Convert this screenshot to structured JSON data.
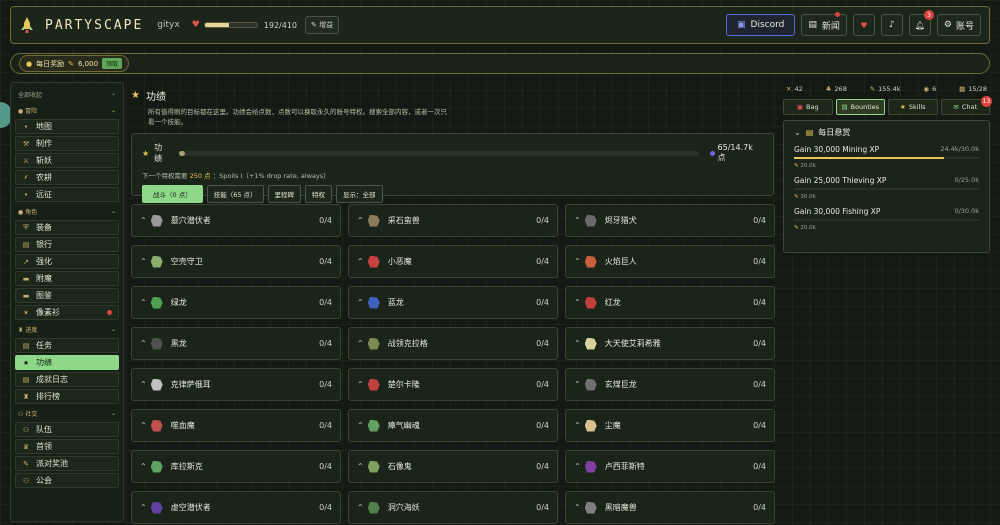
{
  "header": {
    "logo": "PARTYSCAPE",
    "username": "gityx",
    "hp_text": "192/410",
    "hp_fraction": 0.468,
    "boost_label": "增益",
    "discord_label": "Discord",
    "news_label": "新闻",
    "notif_badge": "3",
    "account_label": "账号"
  },
  "daily": {
    "label": "每日奖励",
    "amount": "6,000",
    "claim_label": "领取"
  },
  "sidebar": {
    "collapse_all": "全部收起",
    "sections": [
      {
        "label": "冒险",
        "items": [
          {
            "label": "地图",
            "icon": "•"
          },
          {
            "label": "制作",
            "icon": "⚒"
          },
          {
            "label": "斩妖",
            "icon": "⚔"
          },
          {
            "label": "农耕",
            "icon": "⸙"
          },
          {
            "label": "远征",
            "icon": "•"
          }
        ]
      },
      {
        "label": "角色",
        "items": [
          {
            "label": "装备",
            "icon": "⛨"
          },
          {
            "label": "银行",
            "icon": "▤"
          },
          {
            "label": "强化",
            "icon": "↗"
          },
          {
            "label": "附魔",
            "icon": "▬"
          },
          {
            "label": "图鉴",
            "icon": "▬"
          },
          {
            "label": "像素衫",
            "icon": "✶"
          }
        ]
      },
      {
        "label": "进度",
        "items": [
          {
            "label": "任务",
            "icon": "▤"
          },
          {
            "label": "功绩",
            "icon": "★"
          },
          {
            "label": "成就日志",
            "icon": "▤"
          },
          {
            "label": "排行榜",
            "icon": "♜"
          }
        ]
      },
      {
        "label": "社交",
        "items": [
          {
            "label": "队伍",
            "icon": "⚇"
          },
          {
            "label": "首领",
            "icon": "♛"
          },
          {
            "label": "派对奖池",
            "icon": "✎"
          },
          {
            "label": "公会",
            "icon": "⚇"
          }
        ]
      }
    ]
  },
  "main": {
    "title": "功绩",
    "description": "所有值得刷的目标都在这里。功绩会给点数，点数可以换取永久的账号特权。搜索全部内容，或者一次只看一个技能。",
    "panel_label": "功绩",
    "points": "65/14.7k 点",
    "points_fraction": 0.006,
    "next_prefix": "下一个特权需要",
    "next_points": "250 点",
    "next_suffix": "：Spoils I（+1% drop rate, always）",
    "tabs": [
      "战斗（0 点）",
      "技能（65 点）",
      "里程碑",
      "特权",
      "显示：全部"
    ],
    "cards": [
      {
        "name": "墓穴潜伏者",
        "count": "0/4",
        "color": "#9a9a9a"
      },
      {
        "name": "采石蛮兽",
        "count": "0/4",
        "color": "#8a7a5a"
      },
      {
        "name": "烬牙猎犬",
        "count": "0/4",
        "color": "#6a6a6a"
      },
      {
        "name": "空壳守卫",
        "count": "0/4",
        "color": "#8ab070"
      },
      {
        "name": "小恶魔",
        "count": "0/4",
        "color": "#c84040"
      },
      {
        "name": "火焰巨人",
        "count": "0/4",
        "color": "#c86040"
      },
      {
        "name": "绿龙",
        "count": "0/4",
        "color": "#50a050"
      },
      {
        "name": "蓝龙",
        "count": "0/4",
        "color": "#4060c0"
      },
      {
        "name": "红龙",
        "count": "0/4",
        "color": "#c04040"
      },
      {
        "name": "黑龙",
        "count": "0/4",
        "color": "#505050"
      },
      {
        "name": "战领克拉格",
        "count": "0/4",
        "color": "#7a8a50"
      },
      {
        "name": "大天使艾莉希雅",
        "count": "0/4",
        "color": "#d8d0a0"
      },
      {
        "name": "克律萨俄耳",
        "count": "0/4",
        "color": "#c0c0c0"
      },
      {
        "name": "楚尔卡隆",
        "count": "0/4",
        "color": "#c04040"
      },
      {
        "name": "玄煤巨龙",
        "count": "0/4",
        "color": "#707070"
      },
      {
        "name": "噬血魔",
        "count": "0/4",
        "color": "#c05050"
      },
      {
        "name": "瘴气幽魂",
        "count": "0/4",
        "color": "#60a060"
      },
      {
        "name": "尘魔",
        "count": "0/4",
        "color": "#d8c090"
      },
      {
        "name": "库拉斯克",
        "count": "0/4",
        "color": "#60a060"
      },
      {
        "name": "石像鬼",
        "count": "0/4",
        "color": "#80a060"
      },
      {
        "name": "卢西菲斯特",
        "count": "0/4",
        "color": "#8040a0"
      },
      {
        "name": "虚空潜伏者",
        "count": "0/4",
        "color": "#6040a0"
      },
      {
        "name": "洞穴海妖",
        "count": "0/4",
        "color": "#508050"
      },
      {
        "name": "黑暗魔兽",
        "count": "0/4",
        "color": "#808080"
      }
    ]
  },
  "right": {
    "stats": [
      {
        "icon": "✕",
        "value": "42"
      },
      {
        "icon": "♣",
        "value": "268"
      },
      {
        "icon": "✎",
        "value": "155.4k"
      },
      {
        "icon": "◉",
        "value": "6"
      },
      {
        "icon": "▦",
        "value": "15/28"
      }
    ],
    "tabs": [
      "Bag",
      "Bounties",
      "Skills",
      "Chat"
    ],
    "chat_badge": "13",
    "bounty_title": "每日悬赏",
    "bounties": [
      {
        "task": "Gain 30,000 Mining XP",
        "progress": "24.4k/30.0k",
        "fraction": 0.813,
        "reward": "20.0k"
      },
      {
        "task": "Gain 25,000 Thieving XP",
        "progress": "0/25.0k",
        "fraction": 0,
        "reward": "30.0k"
      },
      {
        "task": "Gain 30,000 Fishing XP",
        "progress": "0/30.0k",
        "fraction": 0,
        "reward": "20.0k"
      }
    ]
  },
  "colors": {
    "accent": "#8fd88a",
    "gold": "#e8c65a",
    "border": "#6e6a3a"
  }
}
